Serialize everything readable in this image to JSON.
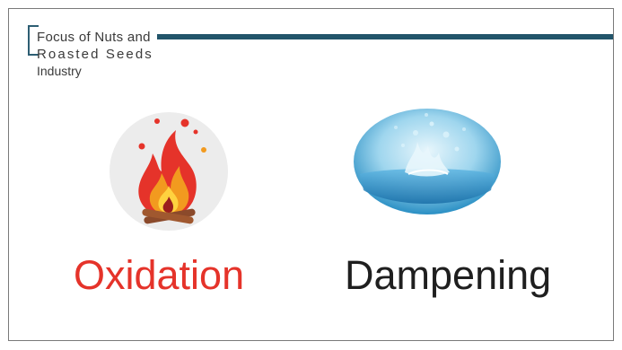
{
  "header": {
    "title_lines": [
      "Focus of Nuts and",
      "Roasted Seeds",
      "Industry"
    ]
  },
  "items": [
    {
      "label": "Oxidation",
      "icon": "fire-icon",
      "color": "#e5332a"
    },
    {
      "label": "Dampening",
      "icon": "water-splash-icon",
      "color": "#1f1f1f"
    }
  ],
  "colors": {
    "accent": "#22556a",
    "frame": "#7a7a7a"
  }
}
